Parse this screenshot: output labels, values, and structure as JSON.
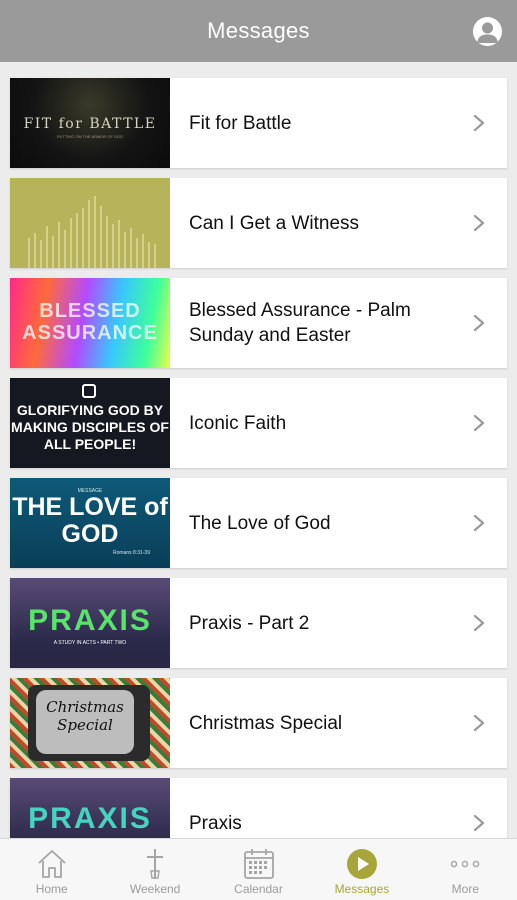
{
  "header": {
    "title": "Messages",
    "profile_icon": "user-circle-icon"
  },
  "colors": {
    "header_bg": "#9a9a9a",
    "accent": "#a8a53a",
    "tab_inactive": "#9b9b9b"
  },
  "messages": [
    {
      "title": "Fit for Battle",
      "thumb_text": "FIT for BATTLE",
      "thumb_sub": "PUTTING ON THE ARMOR OF GOD"
    },
    {
      "title": "Can I Get a Witness"
    },
    {
      "title": "Blessed Assurance - Palm Sunday and Easter",
      "thumb_text": "BLESSED ASSURANCE"
    },
    {
      "title": "Iconic Faith",
      "thumb_text": "GLORIFYING GOD BY MAKING DISCIPLES OF ALL PEOPLE!"
    },
    {
      "title": "The Love of God",
      "thumb_text": "THE LOVE of GOD",
      "thumb_small": "MESSAGE",
      "thumb_ref": "Romans 8:31-39"
    },
    {
      "title": "Praxis - Part 2",
      "thumb_text": "PRAXIS",
      "thumb_sub": "A STUDY IN ACTS • PART TWO"
    },
    {
      "title": "Christmas Special",
      "thumb_text": "Christmas Special"
    },
    {
      "title": "Praxis",
      "thumb_text": "PRAXIS"
    }
  ],
  "tabs": [
    {
      "label": "Home",
      "icon": "home-icon"
    },
    {
      "label": "Weekend",
      "icon": "cross-icon"
    },
    {
      "label": "Calendar",
      "icon": "calendar-icon"
    },
    {
      "label": "Messages",
      "icon": "play-circle-icon",
      "active": true
    },
    {
      "label": "More",
      "icon": "more-dots-icon"
    }
  ]
}
